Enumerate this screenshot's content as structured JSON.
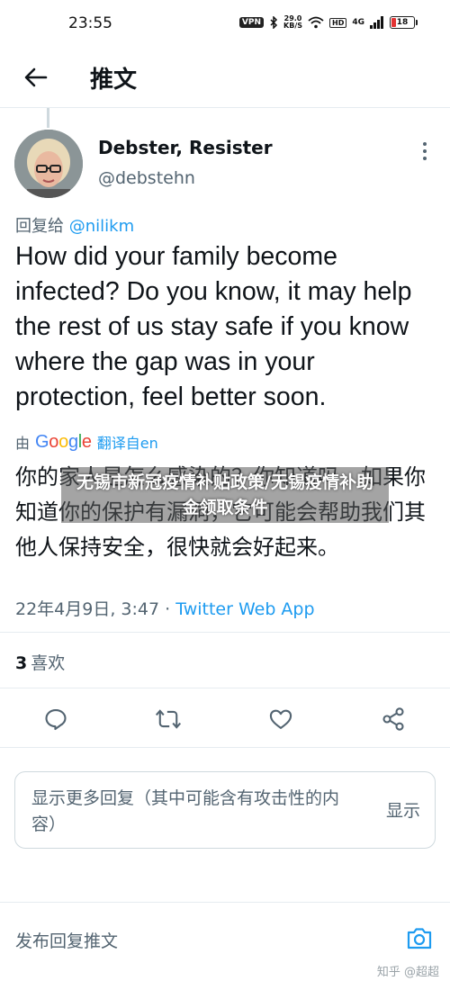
{
  "status_bar": {
    "time": "23:55",
    "vpn": "VPN",
    "net_speed_value": "29.0",
    "net_speed_unit": "KB/S",
    "hd": "HD",
    "network": "4G",
    "battery": "18",
    "battery_level": 0.18,
    "battery_color": "#e33333"
  },
  "header": {
    "back_icon": "arrow-left-icon",
    "title": "推文"
  },
  "tweet": {
    "author_name": "Debster, Resister",
    "author_handle": "@debstehn",
    "reply_prefix": "回复给",
    "reply_handle": "@nilikm",
    "text": "How did your family become infected? Do you know, it may help the rest of us stay safe if you know where the gap was in your protection, feel better soon.",
    "translate_prefix": "由",
    "translate_provider": "Google",
    "translate_link": "翻译自en",
    "translated_text": "你的家人是怎么感染的？你知道吗，如果你知道你的保护有漏洞，它可能会帮助我们其他人保持安全，很快就会好起来。",
    "timestamp": "22年4月9日, 3:47",
    "separator": " · ",
    "source": "Twitter Web App",
    "likes_count": "3",
    "likes_label": "喜欢"
  },
  "overlay": {
    "text": "无锡市新冠疫情补贴政策/无锡疫情补助金领取条件"
  },
  "actions": {
    "reply_icon": "reply-icon",
    "retweet_icon": "retweet-icon",
    "like_icon": "heart-icon",
    "share_icon": "share-icon"
  },
  "show_more": {
    "text": "显示更多回复（其中可能含有攻击性的内容）",
    "button": "显示"
  },
  "compose": {
    "placeholder": "发布回复推文",
    "camera_icon": "camera-icon"
  },
  "watermark": "知乎 @超超",
  "colors": {
    "accent": "#1d9bf0",
    "text": "#0f1419",
    "muted": "#536471",
    "border": "#e6ecf0"
  }
}
